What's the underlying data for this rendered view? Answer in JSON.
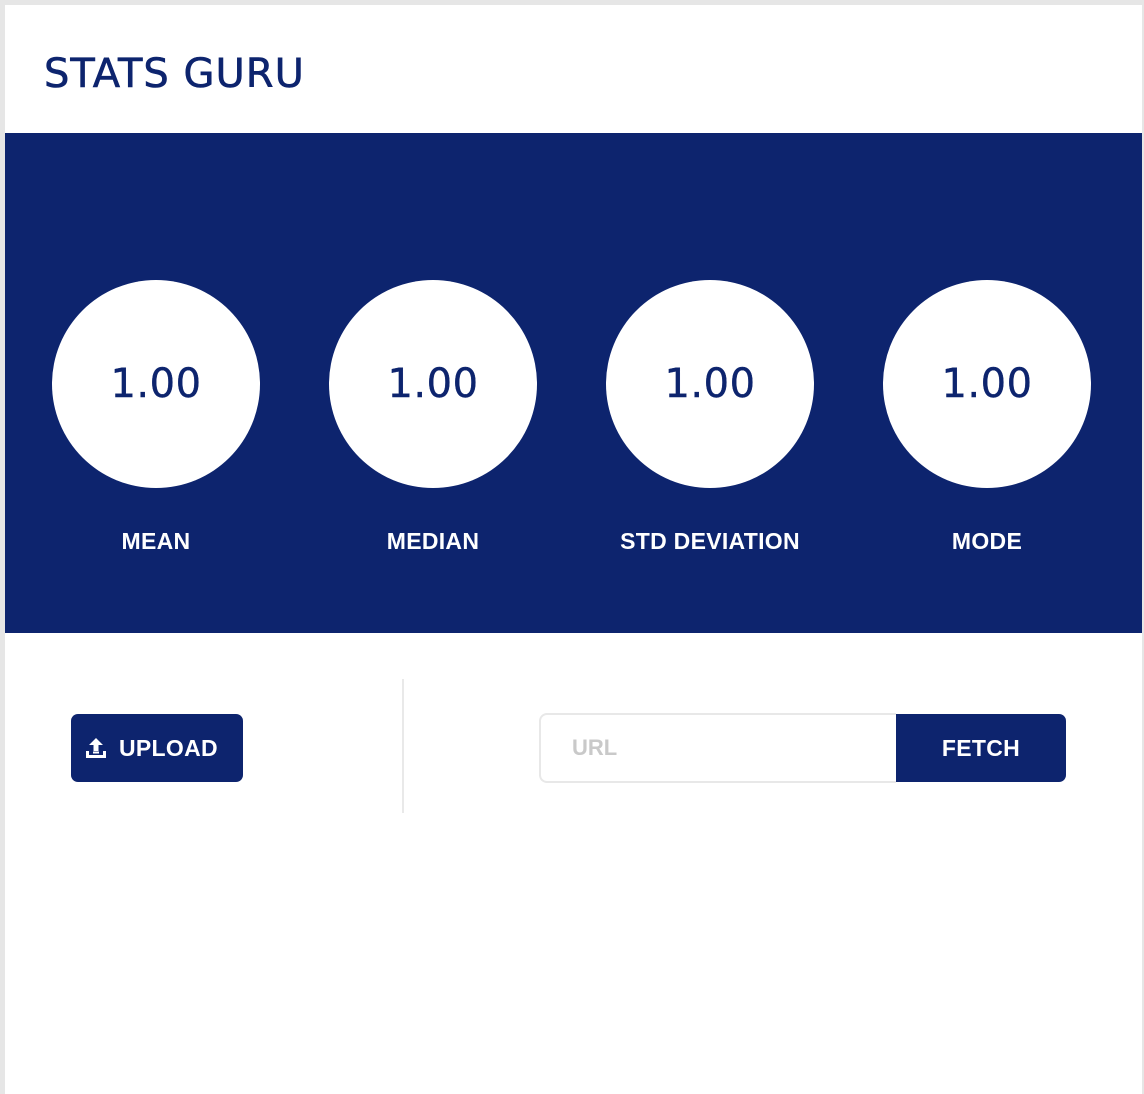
{
  "app": {
    "title": "STATS GURU"
  },
  "colors": {
    "brand": "#0d246e",
    "surface": "#ffffff",
    "placeholder": "#c9c9c9"
  },
  "stats": [
    {
      "value": "1.00",
      "label": "MEAN"
    },
    {
      "value": "1.00",
      "label": "MEDIAN"
    },
    {
      "value": "1.00",
      "label": "STD DEVIATION"
    },
    {
      "value": "1.00",
      "label": "MODE"
    }
  ],
  "upload": {
    "label": "UPLOAD",
    "icon": "upload-icon"
  },
  "fetch": {
    "url_value": "",
    "url_placeholder": "URL",
    "button_label": "FETCH"
  }
}
